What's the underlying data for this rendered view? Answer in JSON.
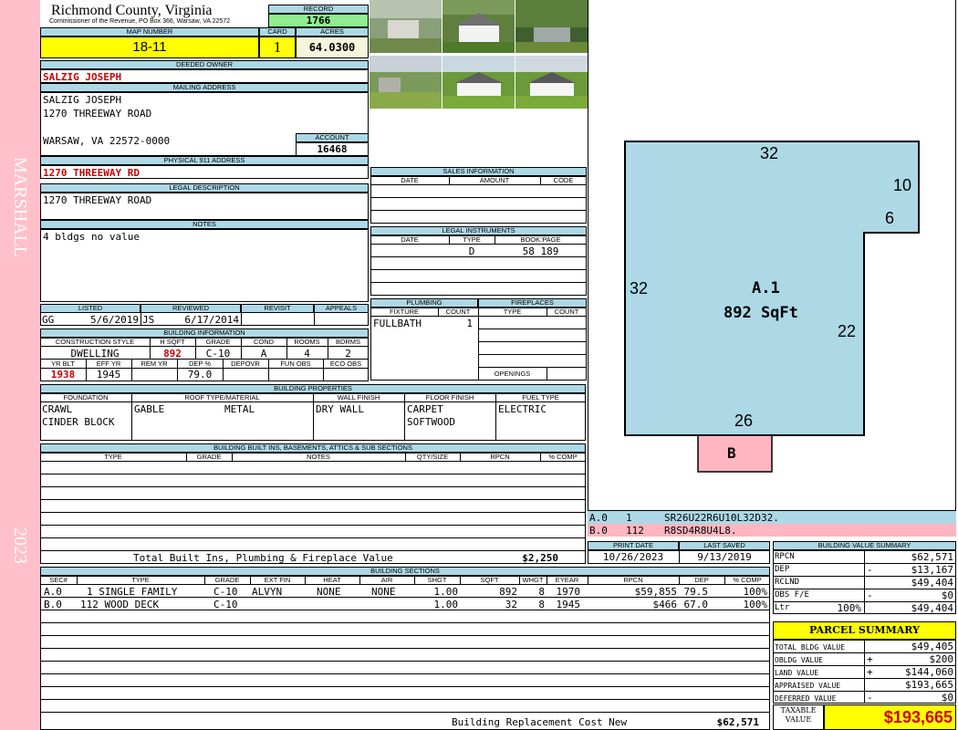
{
  "sidebar": {
    "district": "MARSHALL",
    "year": "2023"
  },
  "header": {
    "county": "Richmond County, Virginia",
    "commissioner": "Commissioner of the Revenue, PO Box 366, Warsaw, VA 22572",
    "record_label": "RECORD",
    "record": "1766",
    "map_label": "MAP NUMBER",
    "map_number": "18-11",
    "card_label": "CARD",
    "card": "1",
    "acres_label": "ACRES",
    "acres": "64.0300"
  },
  "owner": {
    "deeded_label": "DEEDED OWNER",
    "deeded_owner": "SALZIG JOSEPH",
    "mailing_label": "MAILING ADDRESS",
    "mailing_lines": [
      "SALZIG JOSEPH",
      "1270 THREEWAY ROAD",
      "",
      "WARSAW, VA 22572-0000"
    ],
    "account_label": "ACCOUNT",
    "account": "16468",
    "physical_label": "PHYSICAL 911 ADDRESS",
    "physical_address": "1270 THREEWAY RD",
    "legal_label": "LEGAL DESCRIPTION",
    "legal_description": "1270 THREEWAY ROAD",
    "notes_label": "NOTES",
    "notes": "4 bldgs no value"
  },
  "sales": {
    "title": "SALES INFORMATION",
    "cols": [
      "DATE",
      "AMOUNT",
      "CODE"
    ]
  },
  "legal_instruments": {
    "title": "LEGAL INSTRUMENTS",
    "cols": [
      "DATE",
      "TYPE",
      "BOOK:PAGE"
    ],
    "row": {
      "type": "D",
      "bookpage": "58 189"
    }
  },
  "plumbing": {
    "title": "PLUMBING",
    "cols": [
      "FIXTURE",
      "COUNT"
    ],
    "fixture": "FULLBATH",
    "count": "1"
  },
  "fireplaces": {
    "title": "FIREPLACES",
    "cols": [
      "TYPE",
      "COUNT"
    ],
    "openings_label": "OPENINGS"
  },
  "review": {
    "cols": [
      "LISTED",
      "REVIEWED",
      "REVISIT",
      "APPEALS"
    ],
    "listed_by": "GG",
    "listed_date": "5/6/2019",
    "reviewed_by": "JS",
    "reviewed_date": "6/17/2014"
  },
  "building_info": {
    "title": "BUILDING INFORMATION",
    "cols1": [
      "CONSTRUCTION STYLE",
      "H SQFT",
      "GRADE",
      "COND",
      "ROOMS",
      "BDRMS"
    ],
    "style": "DWELLING",
    "hsqft": "892",
    "grade": "C-10",
    "cond": "A",
    "rooms": "4",
    "bdrms": "2",
    "cols2": [
      "YR BLT",
      "EFF YR",
      "REM YR",
      "DEP %",
      "DEPOVR",
      "FUN OBS",
      "ECO OBS"
    ],
    "yr_blt": "1938",
    "eff_yr": "1945",
    "dep": "79.0"
  },
  "building_properties": {
    "title": "BUILDING PROPERTIES",
    "cols": [
      "FOUNDATION",
      "ROOF TYPE/MATERIAL",
      "WALL FINISH",
      "FLOOR FINISH",
      "FUEL TYPE"
    ],
    "foundation": [
      "CRAWL",
      "CINDER BLOCK"
    ],
    "roof_type": "GABLE",
    "roof_material": "METAL",
    "wall": "DRY WALL",
    "floor": [
      "CARPET",
      "SOFTWOOD"
    ],
    "fuel": "ELECTRIC"
  },
  "builtins": {
    "title": "BUILDING BUILT INS, BASEMENTS, ATTICS & SUB SECTIONS",
    "cols": [
      "TYPE",
      "GRADE",
      "NOTES",
      "QTY/SIZE",
      "RPCN",
      "% COMP"
    ],
    "total_label": "Total Built Ins, Plumbing & Fireplace Value",
    "total_value": "$2,250"
  },
  "print_info": {
    "print_label": "PRINT DATE",
    "print_date": "10/26/2023",
    "saved_label": "LAST SAVED",
    "saved_date": "9/13/2019"
  },
  "sections": {
    "title": "BUILDING SECTIONS",
    "cols": [
      "SEC#",
      "TYPE",
      "GRADE",
      "EXT FIN",
      "HEAT",
      "AIR",
      "SHGT",
      "SQFT",
      "WHGT",
      "EYEAR",
      "RPCN",
      "DEP",
      "% COMP"
    ],
    "rows": [
      {
        "sec": "A.0",
        "type": "1 SINGLE FAMILY",
        "grade": "C-10",
        "ext": "ALVYN",
        "heat": "NONE",
        "air": "NONE",
        "shgt": "1.00",
        "sqft": "892",
        "whgt": "8",
        "eyear": "1970",
        "rpcn": "$59,855",
        "dep": "79.5",
        "comp": "100%"
      },
      {
        "sec": "B.0",
        "type": "112 WOOD DECK",
        "grade": "C-10",
        "ext": "",
        "heat": "",
        "air": "",
        "shgt": "1.00",
        "sqft": "32",
        "whgt": "8",
        "eyear": "1945",
        "rpcn": "$466",
        "dep": "67.0",
        "comp": "100%"
      }
    ],
    "replacement_label": "Building Replacement Cost New",
    "replacement_value": "$62,571"
  },
  "sketch": {
    "top": "32",
    "right_top": "10",
    "notch": "6",
    "left": "32",
    "right": "22",
    "bottom": "26",
    "label": "A.1",
    "area": "892 SqFt",
    "deck": "B",
    "legend": [
      {
        "sec": "A.0",
        "code": "1",
        "desc": "SR26U22R6U10L32D32."
      },
      {
        "sec": "B.0",
        "code": "112",
        "desc": "R8SD4R8U4L8."
      }
    ]
  },
  "value_summary": {
    "title": "BUILDING VALUE SUMMARY",
    "rows": [
      {
        "label": "RPCN",
        "sign": "",
        "value": "$62,571"
      },
      {
        "label": "DEP",
        "sign": "-",
        "value": "$13,167"
      },
      {
        "label": "RCLND",
        "sign": "",
        "value": "$49,404"
      },
      {
        "label": "OBS F/E",
        "sign": "-",
        "value": "$0"
      },
      {
        "label": "Ltr",
        "sign": "100%",
        "value": "$49,404"
      }
    ]
  },
  "parcel_summary": {
    "title": "PARCEL SUMMARY",
    "rows": [
      {
        "label": "TOTAL BLDG VALUE",
        "sign": "",
        "value": "$49,405"
      },
      {
        "label": "OBLDG VALUE",
        "sign": "+",
        "value": "$200"
      },
      {
        "label": "LAND VALUE",
        "sign": "+",
        "value": "$144,060"
      },
      {
        "label": "APPRAISED VALUE",
        "sign": "",
        "value": "$193,665"
      },
      {
        "label": "DEFERRED VALUE",
        "sign": "-",
        "value": "$0"
      }
    ],
    "taxable_label_1": "TAXABLE",
    "taxable_label_2": "VALUE",
    "taxable_value": "$193,665"
  },
  "colors": {
    "header_blue": "#add8e6",
    "highlight_yellow": "#ffff00",
    "record_green": "#90ee90",
    "sidebar_pink": "#ffc0cb",
    "sketch_blue": "#add8e6",
    "deck_pink": "#ffb6c1",
    "value_red": "#cc0000"
  }
}
